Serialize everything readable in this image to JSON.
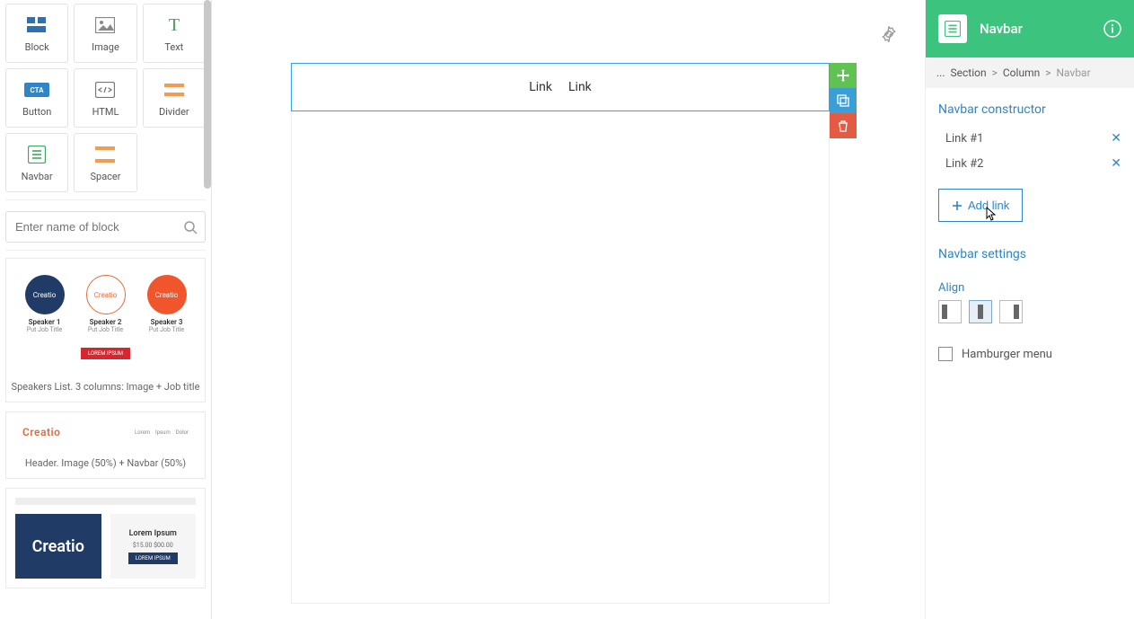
{
  "sidebar": {
    "tools": [
      {
        "label": "Block"
      },
      {
        "label": "Image"
      },
      {
        "label": "Text"
      },
      {
        "label": "Button"
      },
      {
        "label": "HTML"
      },
      {
        "label": "Divider"
      },
      {
        "label": "Navbar"
      },
      {
        "label": "Spacer"
      }
    ],
    "search_placeholder": "Enter name of block",
    "templates": [
      {
        "caption": "Speakers List. 3 columns: Image + Job title",
        "brand": "Creatio",
        "speakers": [
          {
            "name": "Speaker 1",
            "title": "Put Job Title"
          },
          {
            "name": "Speaker 2",
            "title": "Put Job Title"
          },
          {
            "name": "Speaker 3",
            "title": "Put Job Title"
          }
        ],
        "button": "LOREM IPSUM"
      },
      {
        "caption": "Header. Image (50%) + Navbar (50%)",
        "brand": "Creatio",
        "nav": [
          "Lorem",
          "Ipsum",
          "Dolor"
        ]
      },
      {
        "caption": "",
        "brand": "Creatio",
        "product_title": "Lorem Ipsum",
        "product_price": "$15.00 $00.00",
        "product_button": "LOREM IPSUM"
      }
    ]
  },
  "canvas": {
    "links": [
      "Link",
      "Link"
    ]
  },
  "panel": {
    "title": "Navbar",
    "breadcrumb": {
      "prefix": "...",
      "items": [
        "Section",
        "Column"
      ],
      "current": "Navbar"
    },
    "constructor_title": "Navbar constructor",
    "links": [
      "Link #1",
      "Link #2"
    ],
    "add_link_label": "Add link",
    "settings_title": "Navbar settings",
    "align_title": "Align",
    "align_selected": "center",
    "hamburger_label": "Hamburger menu",
    "hamburger_checked": false
  }
}
